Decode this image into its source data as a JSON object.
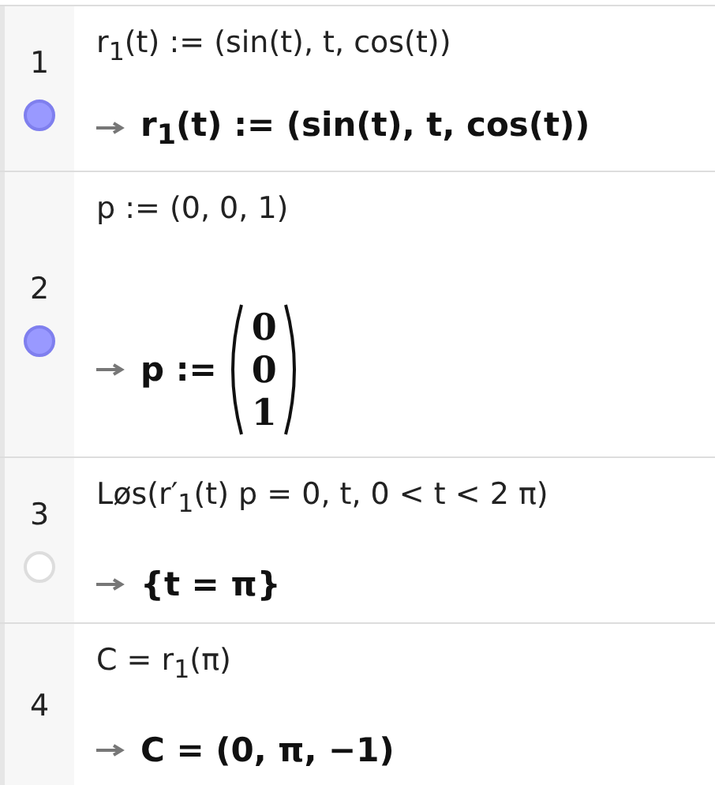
{
  "rows": [
    {
      "number": "1",
      "marble_shown": true,
      "input": "r$_{1}$(t) := (sin(t), t, cos(t))",
      "output": {
        "kind": "text",
        "text": "r$_{1}$(t) := (sin(t), t, cos(t))"
      }
    },
    {
      "number": "2",
      "marble_shown": true,
      "input": "p := (0, 0, 1)",
      "output": {
        "kind": "vector",
        "lhs": "p :=",
        "entries": [
          "0",
          "0",
          "1"
        ]
      }
    },
    {
      "number": "3",
      "marble_shown": false,
      "input": "Løs(r′$_{1}$(t) p = 0, t, 0 < t < 2 π)",
      "output": {
        "kind": "text",
        "text": "{t = π}"
      }
    },
    {
      "number": "4",
      "input": "C = r$_{1}$(π)",
      "output": {
        "kind": "text",
        "text": "C = (0, π, −1)"
      }
    }
  ]
}
